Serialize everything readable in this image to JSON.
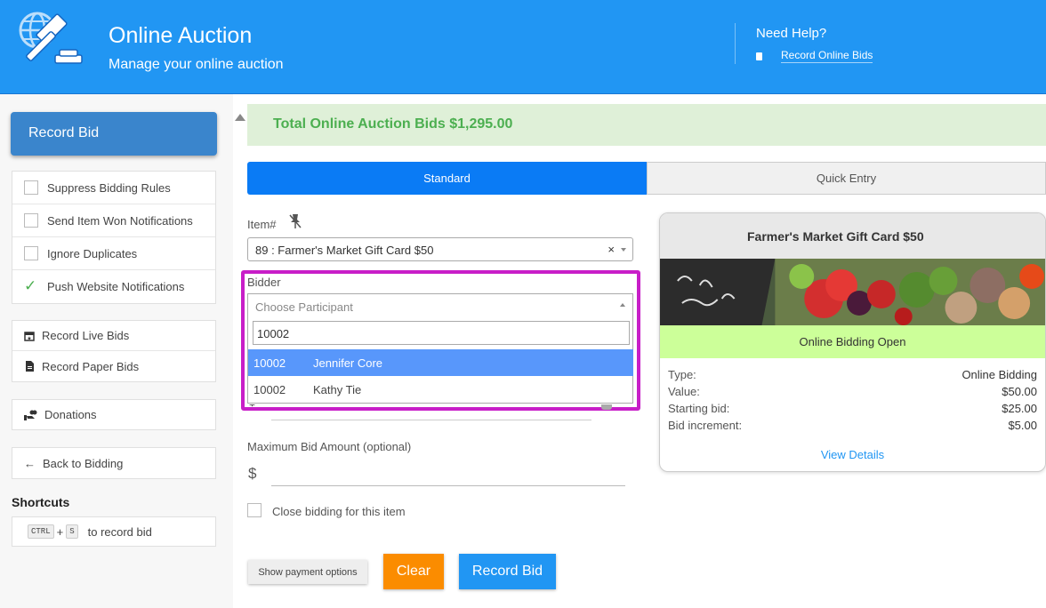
{
  "app": {
    "title": "Online Auction",
    "subtitle": "Manage your online auction",
    "help_title": "Need Help?",
    "help_link": "Record Online Bids"
  },
  "sidebar": {
    "record_bid": "Record Bid",
    "options": [
      {
        "label": "Suppress Bidding Rules",
        "checked": false
      },
      {
        "label": "Send Item Won Notifications",
        "checked": false
      },
      {
        "label": "Ignore Duplicates",
        "checked": false
      },
      {
        "label": "Push Website Notifications",
        "checked": true
      }
    ],
    "record_live": "Record Live Bids",
    "record_paper": "Record Paper Bids",
    "donations": "Donations",
    "back": "Back to Bidding",
    "shortcuts_title": "Shortcuts",
    "shortcut_key1": "CTRL",
    "shortcut_plus": "+",
    "shortcut_key2": "S",
    "shortcut_desc": "to record bid"
  },
  "main": {
    "total_banner": "Total Online Auction Bids $1,295.00",
    "tabs": [
      "Standard",
      "Quick Entry"
    ],
    "item_label": "Item#",
    "item_value": "89 : Farmer's Market Gift Card $50",
    "item_clear": "×",
    "bidder_label": "Bidder",
    "bidder_placeholder": "Choose Participant",
    "search_value": "10002",
    "results": [
      {
        "number": "10002",
        "name": "Jennifer Core"
      },
      {
        "number": "10002",
        "name": "Kathy Tie"
      }
    ],
    "max_label": "Maximum Bid Amount (optional)",
    "currency": "$",
    "close_label": "Close bidding for this item",
    "payment_btn": "Show payment options",
    "clear_btn": "Clear",
    "record_btn": "Record Bid"
  },
  "card": {
    "title": "Farmer's Market Gift Card $50",
    "status": "Online Bidding Open",
    "details": [
      {
        "label": "Type:",
        "value": "Online Bidding"
      },
      {
        "label": "Value:",
        "value": "$50.00"
      },
      {
        "label": "Starting bid:",
        "value": "$25.00"
      },
      {
        "label": "Bid increment:",
        "value": "$5.00"
      }
    ],
    "link": "View Details"
  },
  "colors": {
    "header": "#2196f3",
    "highlight": "#c81ec8",
    "standard_tab": "#0a7bf5",
    "clear": "#fb8c00",
    "banner_text": "#4caf50"
  }
}
